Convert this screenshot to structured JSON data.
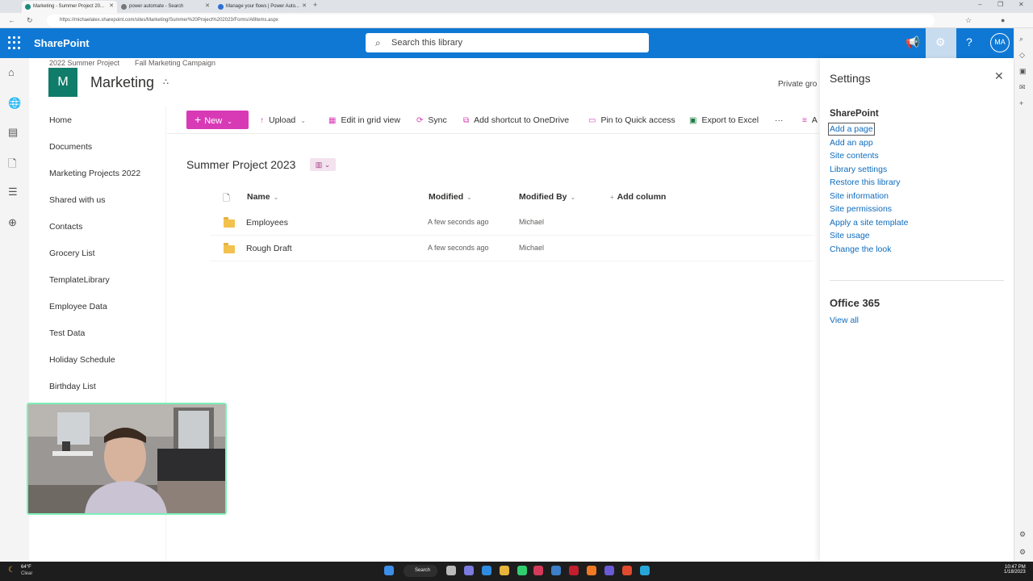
{
  "browser": {
    "tabs": [
      {
        "label": "Marketing - Summer Project 20...",
        "active": true
      },
      {
        "label": "power automate - Search",
        "active": false
      },
      {
        "label": "Manage your flows | Power Auto...",
        "active": false
      }
    ],
    "url": "https://michaelalex.sharepoint.com/sites/Marketing/Summer%20Project%202023/Forms/AllItems.aspx"
  },
  "suite": {
    "brand": "SharePoint",
    "search_placeholder": "Search this library",
    "avatar": "MA"
  },
  "site": {
    "breadcrumbs": [
      "2022 Summer Project",
      "Fall Marketing Campaign"
    ],
    "logo_letter": "M",
    "title": "Marketing",
    "privacy": "Private gro"
  },
  "leftnav": {
    "items": [
      "Home",
      "Documents",
      "Marketing Projects 2022",
      "Shared with us",
      "Contacts",
      "Grocery List",
      "TemplateLibrary",
      "Employee Data",
      "Test Data",
      "Holiday Schedule",
      "Birthday List"
    ]
  },
  "commandbar": {
    "new_label": "New",
    "upload": "Upload",
    "grid": "Edit in grid view",
    "sync": "Sync",
    "shortcut": "Add shortcut to OneDrive",
    "pin": "Pin to Quick access",
    "export": "Export to Excel",
    "more": "···",
    "overflow": "A"
  },
  "library": {
    "title": "Summer Project 2023",
    "columns": {
      "name": "Name",
      "modified": "Modified",
      "modified_by": "Modified By",
      "add": "Add column"
    },
    "rows": [
      {
        "name": "Employees",
        "modified": "A few seconds ago",
        "modified_by": "Michael"
      },
      {
        "name": "Rough Draft",
        "modified": "A few seconds ago",
        "modified_by": "Michael"
      }
    ]
  },
  "settings": {
    "title": "Settings",
    "section1": "SharePoint",
    "links": [
      "Add a page",
      "Add an app",
      "Site contents",
      "Library settings",
      "Restore this library",
      "Site information",
      "Site permissions",
      "Apply a site template",
      "Site usage",
      "Change the look"
    ],
    "section2": "Office 365",
    "view_all": "View all"
  },
  "taskbar": {
    "temp": "64°F",
    "weather": "Clear",
    "search": "Search",
    "time": "10:47 PM",
    "date": "1/18/2023"
  },
  "colors": {
    "suite_blue": "#0f78d4",
    "accent_pink": "#d83ab6",
    "site_logo": "#107c6a",
    "link": "#0f6cbd"
  }
}
